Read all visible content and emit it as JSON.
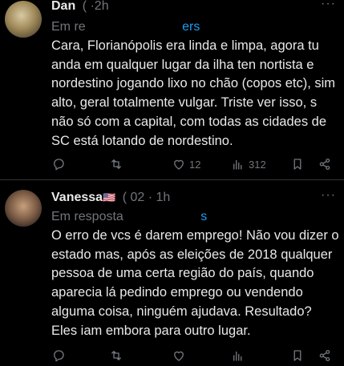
{
  "tweets": [
    {
      "name": "Dan",
      "meta": "( ·2h",
      "reply_prefix": "Em re",
      "reply_handle": "ers",
      "more": "···",
      "text": "Cara, Florianópolis era linda e limpa, agora tu anda em qualquer lugar da ilha ten nortista e nordestino jogando lixo no chão (copos etc), sim alto, geral totalmente vulgar. Triste ver isso, s não só com a capital, com todas as cidades de SC está lotando de nordestino.",
      "actions": {
        "reply_count": "",
        "retweet_count": "",
        "like_count": "12",
        "views_count": "312"
      }
    },
    {
      "name": "Vanessa",
      "flag": "🇺🇸",
      "meta": "( 02 · 1h",
      "reply_prefix": "Em resposta",
      "reply_handle": "s",
      "more": "···",
      "text": "O erro de vcs é darem emprego! Não vou dizer o estado mas, após as eleições de 2018 qualquer pessoa de uma certa região do país, quando aparecia lá pedindo emprego ou vendendo alguma coisa, ninguém ajudava. Resultado? Eles iam embora para outro lugar.",
      "actions": {
        "reply_count": "",
        "retweet_count": "",
        "like_count": "",
        "views_count": ""
      }
    }
  ],
  "icons": {
    "reply": "reply-icon",
    "retweet": "retweet-icon",
    "like": "heart-icon",
    "views": "views-icon",
    "bookmark": "bookmark-icon",
    "share": "share-icon"
  }
}
